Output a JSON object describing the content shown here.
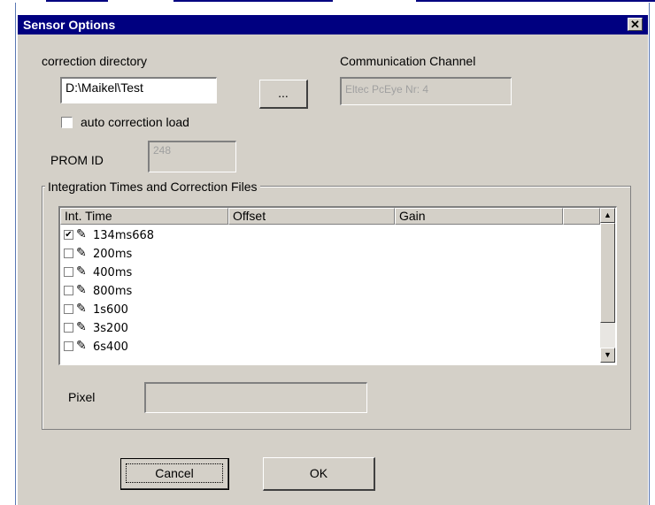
{
  "window": {
    "title": "Sensor Options",
    "close_icon": "close-icon"
  },
  "correction": {
    "label": "correction directory",
    "value": "D:\\Maikel\\Test",
    "browse_label": "..."
  },
  "communication": {
    "label": "Communication Channel",
    "value": "Eltec PcEye Nr: 4"
  },
  "auto_load": {
    "label": "auto correction load",
    "checked": false
  },
  "prom": {
    "label": "PROM ID",
    "value": "248"
  },
  "integration": {
    "group_title": "Integration Times and Correction Files",
    "columns": [
      "Int. Time",
      "Offset",
      "Gain"
    ],
    "rows": [
      {
        "label": "134ms668",
        "checked": true
      },
      {
        "label": "200ms",
        "checked": false
      },
      {
        "label": "400ms",
        "checked": false
      },
      {
        "label": "800ms",
        "checked": false
      },
      {
        "label": "1s600",
        "checked": false
      },
      {
        "label": "3s200",
        "checked": false
      },
      {
        "label": "6s400",
        "checked": false
      }
    ]
  },
  "pixel": {
    "label": "Pixel",
    "value": ""
  },
  "buttons": {
    "cancel": "Cancel",
    "ok": "OK"
  }
}
